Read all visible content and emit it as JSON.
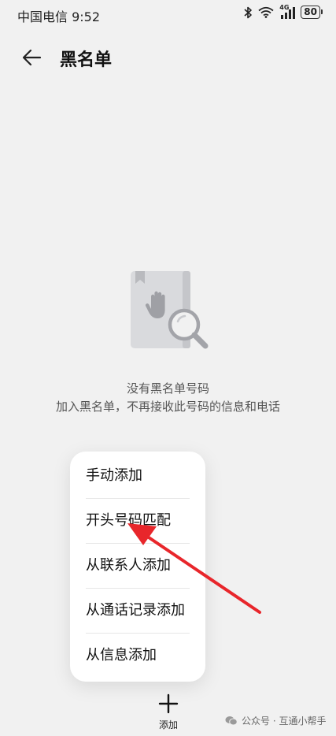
{
  "status_bar": {
    "carrier_time": "中国电信 9:52",
    "network": "4G",
    "battery": "80",
    "icons": [
      "bluetooth-icon",
      "wifi-icon",
      "signal-icon",
      "battery-icon"
    ]
  },
  "header": {
    "back_icon": "arrow-left-icon",
    "title": "黑名单"
  },
  "empty_state": {
    "illustration": "blocked-book-search-icon",
    "title": "没有黑名单号码",
    "description": "加入黑名单，不再接收此号码的信息和电话"
  },
  "menu": {
    "items": [
      {
        "label": "手动添加"
      },
      {
        "label": "开头号码匹配"
      },
      {
        "label": "从联系人添加"
      },
      {
        "label": "从通话记录添加"
      },
      {
        "label": "从信息添加"
      }
    ]
  },
  "bottom_action": {
    "icon": "plus-icon",
    "label": "添加"
  },
  "watermark": {
    "icon": "wechat-icon",
    "text": "公众号 · 互通小帮手"
  },
  "annotation": {
    "color": "#e8262b"
  }
}
